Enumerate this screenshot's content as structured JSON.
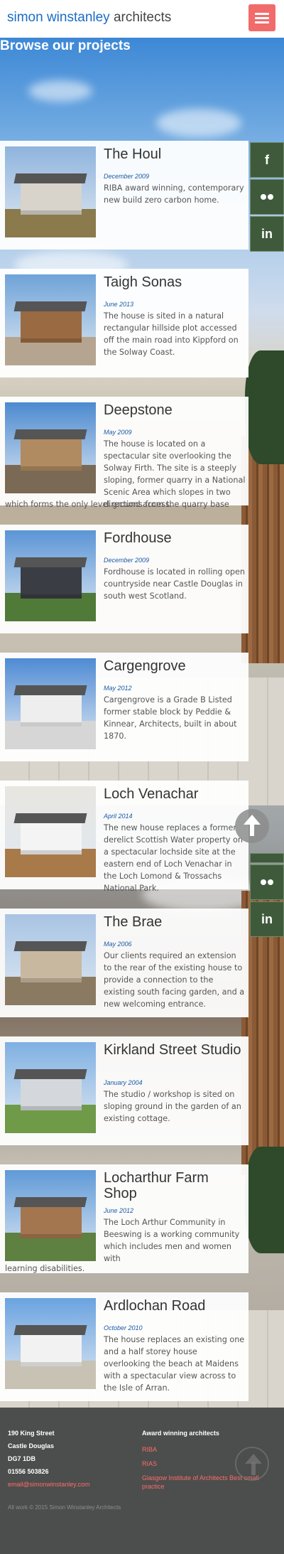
{
  "header": {
    "brand_name": "simon winstanley",
    "brand_rest": " architects",
    "menu_icon": "hamburger-icon"
  },
  "page_title": "Browse our projects",
  "social": {
    "facebook_label": "f",
    "linkedin_label": "in",
    "icons": [
      "facebook-icon",
      "flickr-icon",
      "linkedin-icon"
    ]
  },
  "projects": [
    {
      "name": "The Houl",
      "date": "December 2009",
      "desc": "RIBA award winning, contemporary new build zero carbon home."
    },
    {
      "name": "Taigh Sonas",
      "date": "June 2013",
      "desc": "The house is sited in a natural rectangular hillside plot accessed off the main road into Kippford on the Solway Coast."
    },
    {
      "name": "Deepstone",
      "date": "May 2009",
      "desc": "The house is located on a spectacular site overlooking the Solway Firth. The site is a steeply sloping, former quarry in a National Scenic Area which slopes in two directions from the quarry base",
      "overflow": "which forms the only level ground access."
    },
    {
      "name": "Fordhouse",
      "date": "December 2009",
      "desc": "Fordhouse is located in rolling open countryside near Castle Douglas in south west Scotland."
    },
    {
      "name": "Cargengrove",
      "date": "May 2012",
      "desc": "Cargengrove is a Grade B Listed former stable block by Peddie & Kinnear, Architects, built in about 1870."
    },
    {
      "name": "Loch Venachar",
      "date": "April 2014",
      "desc": "The new house replaces a former derelict Scottish Water property on a spectacular lochside site at the eastern end of Loch Venachar in the Loch Lomond & Trossachs National Park."
    },
    {
      "name": "The Brae",
      "date": "May 2006",
      "desc": "Our clients required an extension to the rear of the existing house to provide a connection to the existing south facing garden, and a new welcoming entrance."
    },
    {
      "name": "Kirkland Street Studio",
      "date": "January 2004",
      "desc": "The studio / workshop is sited on sloping ground in the garden of an existing cottage."
    },
    {
      "name": "Locharthur Farm Shop",
      "date": "June 2012",
      "desc": "The Loch Arthur Community in Beeswing is a working community which includes men and women with",
      "overflow": "learning disabilities."
    },
    {
      "name": "Ardlochan Road",
      "date": "October 2010",
      "desc": "The house replaces an existing one and a half storey house overlooking the beach at Maidens with a spectacular view across to the Isle of Arran."
    }
  ],
  "footer": {
    "address": [
      "190 King Street",
      "Castle Douglas",
      "DG7 1DB",
      "01556 503826"
    ],
    "email": "email@simonwinstanley.com",
    "awards_heading": "Award winning architects",
    "awards": [
      "RIBA",
      "RIAS",
      "Glasgow Institute of Architects Best small practice"
    ],
    "copyright": "All work © 2015 Simon Winstanley Architects"
  },
  "colors": {
    "accent": "#f26b6b",
    "brand_blue": "#1a6cc6",
    "date_blue": "#1a5aa6",
    "social_green": "#3f5a3b",
    "footer_bg": "#4b4e4c",
    "footer_link": "#ff6b6b"
  }
}
